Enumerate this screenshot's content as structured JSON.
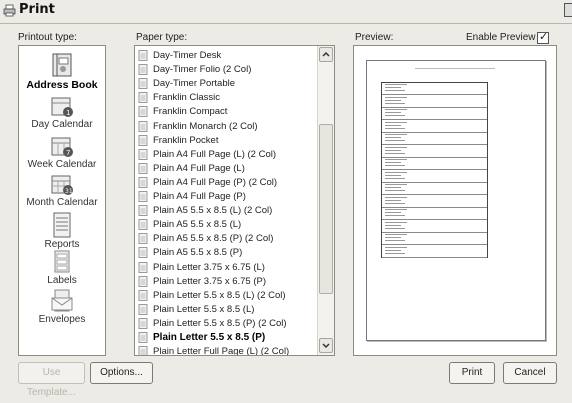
{
  "window": {
    "title": "Print"
  },
  "printout": {
    "label": "Printout type:",
    "items": [
      {
        "label": "Address Book",
        "icon": "address-book-icon",
        "selected": true
      },
      {
        "label": "Day Calendar",
        "icon": "day-calendar-icon"
      },
      {
        "label": "Week Calendar",
        "icon": "week-calendar-icon"
      },
      {
        "label": "Month Calendar",
        "icon": "month-calendar-icon"
      },
      {
        "label": "Reports",
        "icon": "reports-icon"
      },
      {
        "label": "Labels",
        "icon": "labels-icon"
      },
      {
        "label": "Envelopes",
        "icon": "envelopes-icon"
      }
    ]
  },
  "paper": {
    "label": "Paper type:",
    "items": [
      "Day-Timer Desk",
      "Day-Timer Folio (2 Col)",
      "Day-Timer Portable",
      "Franklin Classic",
      "Franklin Compact",
      "Franklin Monarch (2 Col)",
      "Franklin Pocket",
      "Plain A4 Full Page (L) (2 Col)",
      "Plain A4 Full Page (L)",
      "Plain A4 Full Page (P) (2 Col)",
      "Plain A4 Full Page (P)",
      "Plain A5 5.5 x 8.5 (L) (2 Col)",
      "Plain A5 5.5 x 8.5 (L)",
      "Plain A5 5.5 x 8.5 (P) (2 Col)",
      "Plain A5 5.5 x 8.5 (P)",
      "Plain Letter 3.75 x 6.75 (L)",
      "Plain Letter 3.75 x 6.75 (P)",
      "Plain Letter 5.5 x 8.5 (L) (2 Col)",
      "Plain Letter 5.5 x 8.5 (L)",
      "Plain Letter 5.5 x 8.5 (P) (2 Col)",
      "Plain Letter 5.5 x 8.5 (P)",
      "Plain Letter Full Page (L) (2 Col)"
    ],
    "selected": "Plain Letter 5.5 x 8.5 (P)"
  },
  "preview": {
    "label": "Preview:",
    "enable_label": "Enable Preview",
    "enable_checked": true
  },
  "buttons": {
    "disabled_label": "Use Template...",
    "options": "Options...",
    "print": "Print",
    "cancel": "Cancel"
  },
  "colors": {
    "background": "#ecebe6",
    "panel": "#ffffff",
    "border": "#8d8b83"
  }
}
